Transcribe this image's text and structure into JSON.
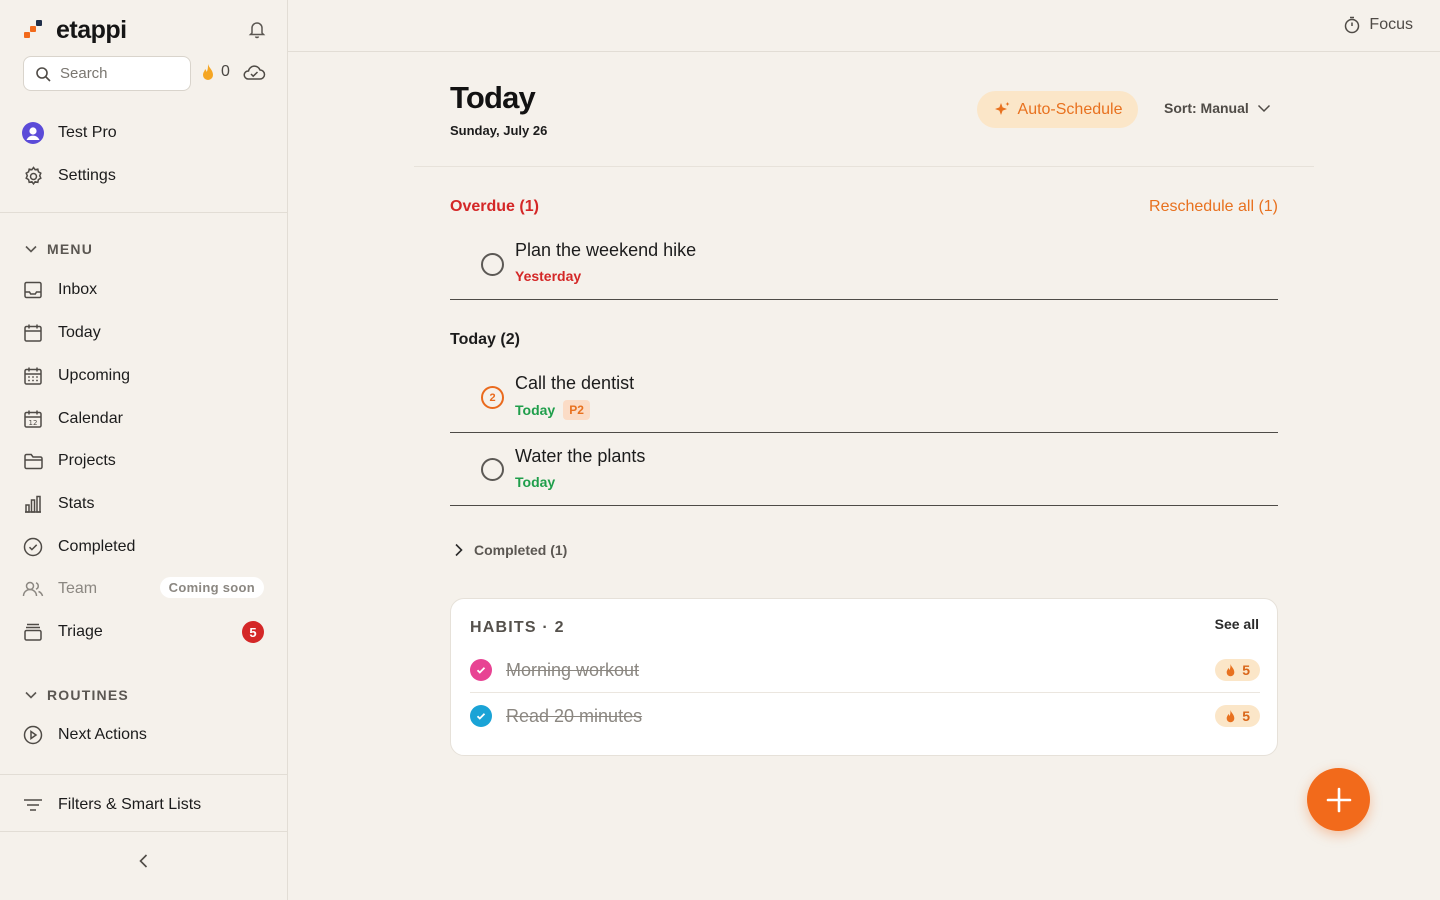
{
  "app": {
    "name": "etappi",
    "accent": "#f26a1b"
  },
  "sidebar": {
    "search_placeholder": "Search",
    "streak_count": "0",
    "user": {
      "name": "Test Pro"
    },
    "settings_label": "Settings",
    "menu_heading": "MENU",
    "items": [
      {
        "label": "Inbox",
        "icon": "inbox-icon"
      },
      {
        "label": "Today",
        "icon": "calendar-icon"
      },
      {
        "label": "Upcoming",
        "icon": "calendar-grid-icon"
      },
      {
        "label": "Calendar",
        "icon": "calendar-12-icon"
      },
      {
        "label": "Projects",
        "icon": "folder-icon"
      },
      {
        "label": "Stats",
        "icon": "bar-chart-icon"
      },
      {
        "label": "Completed",
        "icon": "check-circle-icon"
      },
      {
        "label": "Team",
        "icon": "users-icon",
        "tag": "Coming soon"
      },
      {
        "label": "Triage",
        "icon": "stack-icon",
        "badge": "5"
      }
    ],
    "routines_heading": "ROUTINES",
    "routines": [
      {
        "label": "Next Actions",
        "icon": "play-circle-icon"
      }
    ],
    "filters_label": "Filters & Smart Lists"
  },
  "topbar": {
    "focus_label": "Focus"
  },
  "main": {
    "title": "Today",
    "date": "Sunday, July 26",
    "auto_schedule_label": "Auto-Schedule",
    "sort_label": "Sort: Manual",
    "overdue": {
      "title": "Overdue (1)",
      "reschedule_label": "Reschedule all (1)",
      "tasks": [
        {
          "title": "Plan the weekend hike",
          "due": "Yesterday"
        }
      ]
    },
    "today": {
      "title": "Today (2)",
      "tasks": [
        {
          "title": "Call the dentist",
          "due": "Today",
          "priority": "P2",
          "priority_number": "2"
        },
        {
          "title": "Water the plants",
          "due": "Today"
        }
      ]
    },
    "completed_label": "Completed (1)",
    "habits": {
      "title": "HABITS · 2",
      "see_all_label": "See all",
      "items": [
        {
          "name": "Morning workout",
          "streak": "5",
          "color": "#e84393",
          "done": true
        },
        {
          "name": "Read 20 minutes",
          "streak": "5",
          "color": "#1aa3d6",
          "done": true
        }
      ]
    }
  }
}
